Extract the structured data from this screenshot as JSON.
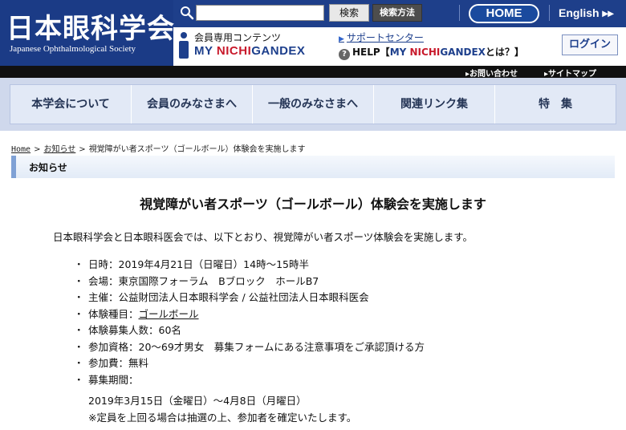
{
  "header": {
    "logo_jp": "日本眼科学会",
    "logo_en": "Japanese Ophthalmological Society",
    "search": {
      "placeholder": "",
      "value": ""
    },
    "search_button": "検索",
    "search_method_button": "検索方法",
    "home_button": "HOME",
    "english_link": "English ▸▸",
    "members_label": "会員専用コンテンツ",
    "mynichigandex": {
      "part1": "MY ",
      "part2": "NICHI",
      "part3": "GANDEX"
    },
    "support_link": "サポートセンター",
    "help_link": {
      "prefix": "HELP【",
      "name1": "MY ",
      "name2": "NICHI",
      "name3": "GANDEX",
      "suffix": "とは？】"
    },
    "login_button": "ログイン"
  },
  "util_nav": {
    "contact": "▸お問い合わせ",
    "sitemap": "▸サイトマップ"
  },
  "main_nav": [
    {
      "label": "本学会について"
    },
    {
      "label": "会員のみなさまへ"
    },
    {
      "label": "一般のみなさまへ"
    },
    {
      "label": "関連リンク集"
    },
    {
      "label": "特　集"
    }
  ],
  "breadcrumb": {
    "home": "Home",
    "news": "お知らせ",
    "current": "視覚障がい者スポーツ（ゴールボール）体験会を実施します",
    "separator": ">"
  },
  "section_title": "お知らせ",
  "article": {
    "title": "視覚障がい者スポーツ（ゴールボール）体験会を実施します",
    "intro": "日本眼科学会と日本眼科医会では、以下とおり、視覚障がい者スポーツ体験会を実施します。",
    "bullet": "・",
    "details": [
      {
        "text": "日時：2019年4月21日（日曜日）14時～15時半"
      },
      {
        "text": "会場：東京国際フォーラム　Bブロック　ホールB7"
      },
      {
        "text": "主催：公益財団法人日本眼科学会 / 公益社団法人日本眼科医会"
      },
      {
        "prefix": "体験種目：",
        "link": "ゴールボール"
      },
      {
        "text": "体験募集人数：60名"
      },
      {
        "text": "参加資格：20～69才男女　募集フォームにある注意事項をご承認頂ける方"
      },
      {
        "text": "参加費：無料"
      },
      {
        "text": "募集期間："
      }
    ],
    "period_line": "2019年3月15日（金曜日）～4月8日（月曜日）",
    "note_line": "※定員を上回る場合は抽選の上、参加者を確定いたします。"
  },
  "colors": {
    "header_blue": "#1e3f8a",
    "brand_red": "#c8192b",
    "nav_bg": "#e2e9f6",
    "section_accent": "#7fa1d5"
  }
}
